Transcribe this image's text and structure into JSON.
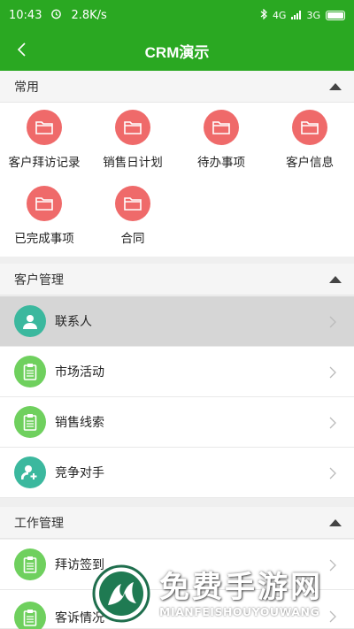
{
  "status_bar": {
    "time": "10:43",
    "speed": "2.8K/s",
    "network1": "4G",
    "network2": "3G"
  },
  "app_bar": {
    "title": "CRM演示"
  },
  "sections": {
    "common": {
      "title": "常用"
    },
    "customer": {
      "title": "客户管理"
    },
    "work": {
      "title": "工作管理"
    }
  },
  "common_items": [
    {
      "label": "客户拜访记录",
      "icon": "folder-icon"
    },
    {
      "label": "销售日计划",
      "icon": "folder-icon"
    },
    {
      "label": "待办事项",
      "icon": "folder-icon"
    },
    {
      "label": "客户信息",
      "icon": "folder-icon"
    },
    {
      "label": "已完成事项",
      "icon": "folder-icon"
    },
    {
      "label": "合同",
      "icon": "folder-icon"
    }
  ],
  "customer_items": [
    {
      "label": "联系人",
      "icon": "person-icon"
    },
    {
      "label": "市场活动",
      "icon": "clipboard-icon"
    },
    {
      "label": "销售线索",
      "icon": "clipboard-icon"
    },
    {
      "label": "竞争对手",
      "icon": "person-add-icon"
    }
  ],
  "work_items": [
    {
      "label": "拜访签到",
      "icon": "clipboard-icon"
    },
    {
      "label": "客诉情况",
      "icon": "clipboard-icon"
    }
  ],
  "watermark": {
    "main": "免费手游网",
    "sub": "MIANFEISHOUYOUWANG"
  },
  "colors": {
    "primary": "#2aa822",
    "folder": "#ef6a6a",
    "teal": "#3bb89e",
    "green": "#6fd05e"
  }
}
